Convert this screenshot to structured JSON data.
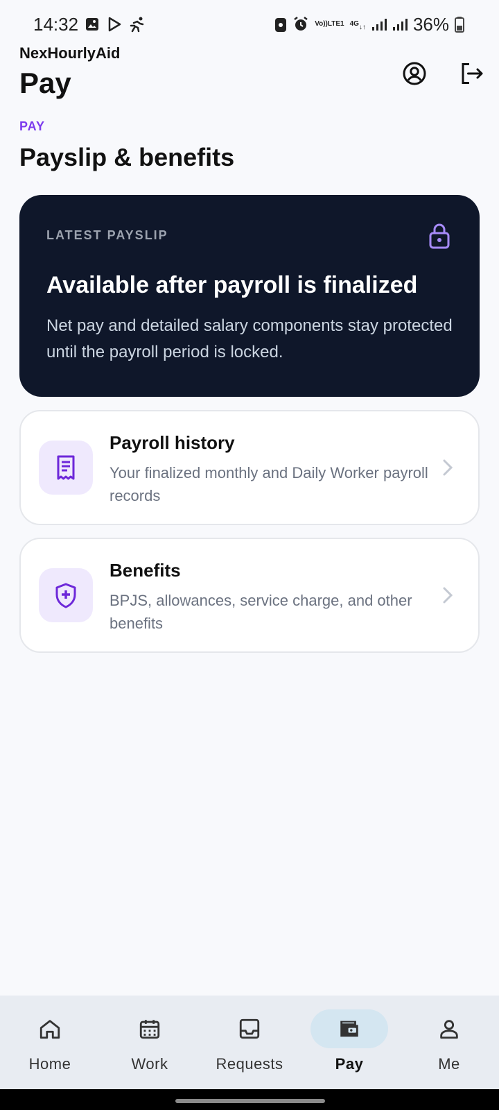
{
  "status_bar": {
    "time": "14:32",
    "left_icons": [
      "image-icon",
      "play-store-icon",
      "running-icon"
    ],
    "network_label_top": "Vo))",
    "network_label_bottom": "LTE1",
    "network_type": "4G",
    "battery": "36%"
  },
  "header": {
    "app_name": "NexHourlyAid",
    "page_title": "Pay",
    "actions": [
      "profile-icon",
      "logout-icon"
    ]
  },
  "section": {
    "eyebrow": "PAY",
    "title": "Payslip & benefits"
  },
  "payslip_card": {
    "eyebrow": "LATEST PAYSLIP",
    "title": "Available after payroll is finalized",
    "description": "Net pay and detailed salary components stay protected until the payroll period is locked.",
    "icon": "lock-icon"
  },
  "cards": [
    {
      "title": "Payroll history",
      "description": "Your finalized monthly and Daily Worker payroll records",
      "icon": "receipt-icon"
    },
    {
      "title": "Benefits",
      "description": "BPJS, allowances, service charge, and other benefits",
      "icon": "shield-plus-icon"
    }
  ],
  "bottom_nav": {
    "items": [
      {
        "label": "Home",
        "icon": "home-icon"
      },
      {
        "label": "Work",
        "icon": "calendar-icon"
      },
      {
        "label": "Requests",
        "icon": "inbox-icon"
      },
      {
        "label": "Pay",
        "icon": "wallet-icon",
        "active": true
      },
      {
        "label": "Me",
        "icon": "person-icon"
      }
    ]
  },
  "colors": {
    "accent": "#7c3aed",
    "dark_card": "#0f172a",
    "icon_bg": "#efe9fd",
    "nav_bg": "#e8ecf2",
    "nav_active": "#d4e6f1"
  }
}
